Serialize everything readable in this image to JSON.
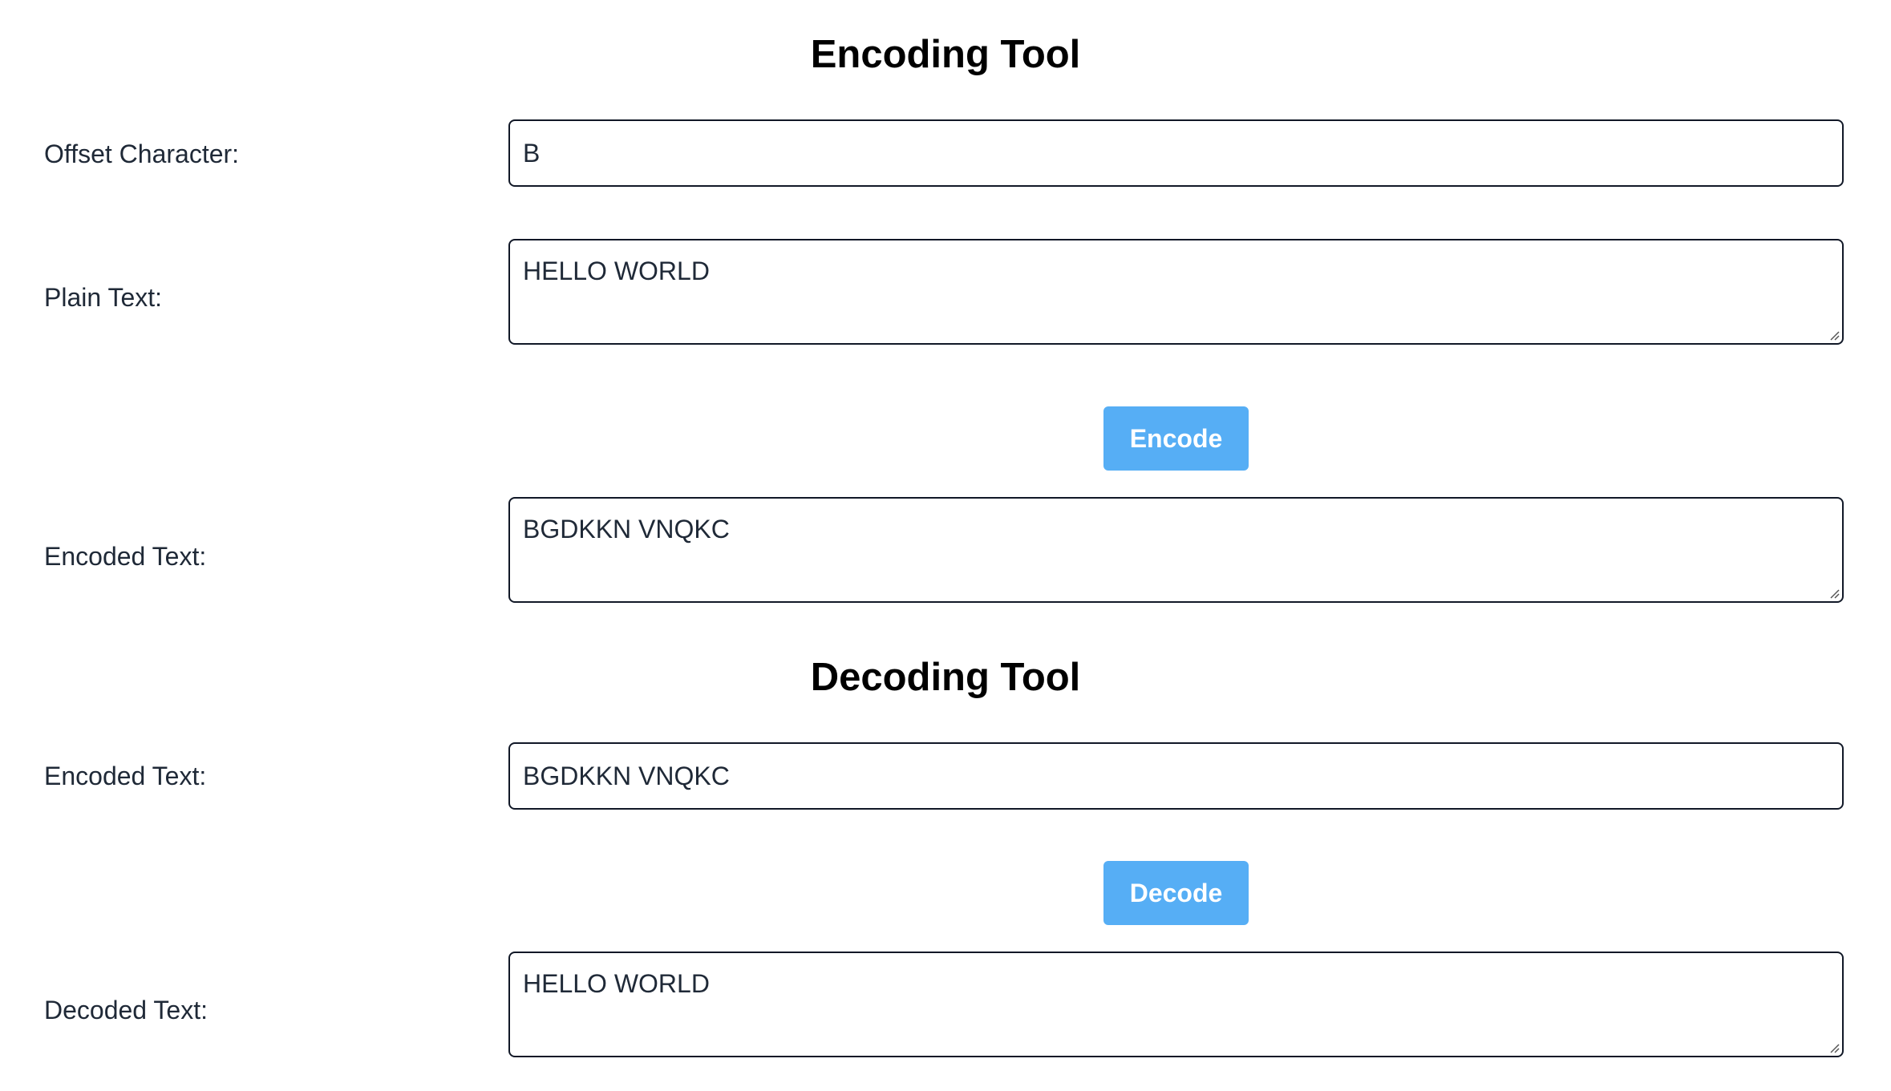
{
  "encoding": {
    "title": "Encoding Tool",
    "offset_label": "Offset Character:",
    "offset_value": "B",
    "plain_label": "Plain Text:",
    "plain_value": "HELLO WORLD",
    "button_label": "Encode",
    "encoded_label": "Encoded Text:",
    "encoded_value": "BGDKKN VNQKC"
  },
  "decoding": {
    "title": "Decoding Tool",
    "encoded_label": "Encoded Text:",
    "encoded_value": "BGDKKN VNQKC",
    "button_label": "Decode",
    "decoded_label": "Decoded Text:",
    "decoded_value": "HELLO WORLD"
  },
  "colors": {
    "button": "#56aef5",
    "button_text": "#ffffff",
    "border": "#111827",
    "text": "#1f2937"
  },
  "icons": {
    "resize_handle": "resize-grip-icon"
  }
}
